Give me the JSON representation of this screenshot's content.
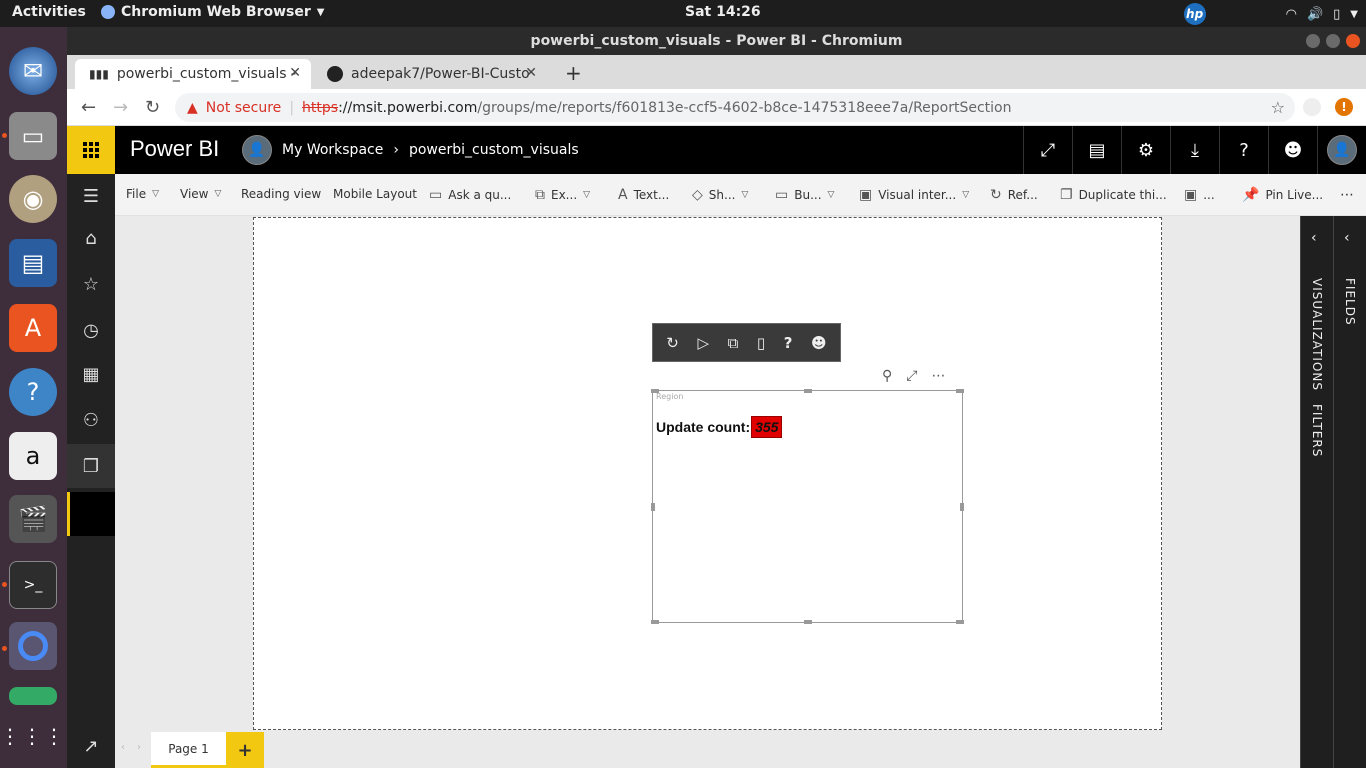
{
  "os_bar": {
    "activities": "Activities",
    "app_name": "Chromium Web Browser",
    "clock": "Sat 14:26",
    "brand_icon": "hp-icon"
  },
  "browser": {
    "window_title": "powerbi_custom_visuals - Power BI - Chromium",
    "tabs": [
      {
        "label": "powerbi_custom_visuals - ",
        "icon": "bar-chart-icon",
        "active": true
      },
      {
        "label": "adeepak7/Power-BI-Custo",
        "icon": "github-icon",
        "active": false
      }
    ],
    "security_label": "Not secure",
    "url_scheme": "https",
    "url_host": "://msit.powerbi.com",
    "url_path": "/groups/me/reports/f601813e-ccf5-4602-b8ce-1475318eee7a/ReportSection"
  },
  "powerbi": {
    "brand": "Power BI",
    "workspace": "My Workspace",
    "report_name": "powerbi_custom_visuals",
    "toolbar": {
      "file": "File",
      "view": "View",
      "reading_view": "Reading view",
      "mobile_layout": "Mobile Layout",
      "ask": "Ask a qu...",
      "explore": "Ex...",
      "text": "Text...",
      "shapes": "Sh...",
      "buttons": "Bu...",
      "visual_interactions": "Visual inter...",
      "refresh": "Ref...",
      "duplicate": "Duplicate thi...",
      "save": "...",
      "pin_live": "Pin Live..."
    },
    "visual": {
      "region_label": "Region",
      "update_label": "Update count:",
      "update_value": "355"
    },
    "panes": {
      "visualizations": "VISUALIZATIONS",
      "filters": "FILTERS",
      "fields": "FIELDS"
    },
    "page_tab": "Page 1",
    "add_page": "+"
  },
  "colors": {
    "accent": "#f2c811",
    "header": "#000000",
    "value_bg": "#e00000"
  }
}
